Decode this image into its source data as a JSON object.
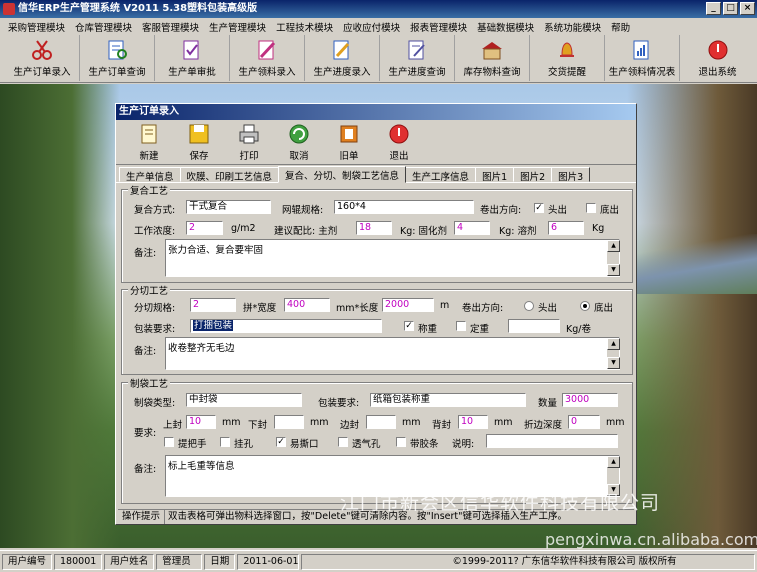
{
  "app": {
    "title": "信华ERP生产管理系统   V2011   5.38塑料包装高级版"
  },
  "window": {
    "min": "_",
    "max": "□",
    "close": "×"
  },
  "menu": [
    "采购管理模块",
    "仓库管理模块",
    "客服管理模块",
    "生产管理模块",
    "工程技术模块",
    "应收应付模块",
    "报表管理模块",
    "基础数据模块",
    "系统功能模块",
    "帮助"
  ],
  "toolbar": [
    {
      "label": "生产订单录入",
      "icon": "scissors-icon",
      "color": "#c02020"
    },
    {
      "label": "生产订单查询",
      "icon": "document-search-icon",
      "color": "#3060c0"
    },
    {
      "label": "生产单审批",
      "icon": "approve-icon",
      "color": "#8030a0"
    },
    {
      "label": "生产领料录入",
      "icon": "pen-icon",
      "color": "#c03080"
    },
    {
      "label": "生产进度录入",
      "icon": "pencil-icon",
      "color": "#3060c0"
    },
    {
      "label": "生产进度查询",
      "icon": "document-pen-icon",
      "color": "#5050a0"
    },
    {
      "label": "库存物料查询",
      "icon": "warehouse-icon",
      "color": "#b02020"
    },
    {
      "label": "交货提醒",
      "icon": "bell-icon",
      "color": "#c03030"
    },
    {
      "label": "生产领料情况表",
      "icon": "report-icon",
      "color": "#3060c0"
    },
    {
      "label": "退出系统",
      "icon": "exit-icon",
      "color": "#d02020"
    }
  ],
  "dialog": {
    "title": "生产订单录入",
    "buttons": [
      {
        "label": "新建",
        "icon": "new-icon"
      },
      {
        "label": "保存",
        "icon": "save-icon"
      },
      {
        "label": "打印",
        "icon": "print-icon"
      },
      {
        "label": "取消",
        "icon": "cancel-icon"
      },
      {
        "label": "旧单",
        "icon": "old-order-icon"
      },
      {
        "label": "退出",
        "icon": "exit-icon"
      }
    ],
    "tabs": [
      "生产单信息",
      "吹膜、印刷工艺信息",
      "复合、分切、制袋工艺信息",
      "生产工序信息",
      "图片1",
      "图片2",
      "图片3"
    ],
    "composite": {
      "legend": "复合工艺",
      "method_label": "复合方式:",
      "method": "干式复合",
      "roll_label": "网辊规格:",
      "roll": "160*4",
      "out_dir_label": "卷出方向:",
      "head": "头出",
      "bottom": "底出",
      "thickness_label": "工作浓度:",
      "thickness": "2",
      "thickness_unit": "g/m2",
      "ratio_label": "建议配比: 主剂",
      "main": "18",
      "kg1": "Kg: 固化剂",
      "cure": "4",
      "kg2": "Kg: 溶剂",
      "solvent": "6",
      "kg3": "Kg",
      "remark_label": "备注:",
      "remark": "张力合适、复合要牢固"
    },
    "slit": {
      "legend": "分切工艺",
      "spec_label": "分切规格:",
      "spec": "2",
      "width_label": "拼*宽度",
      "width": "400",
      "len_label": "mm*长度",
      "len": "2000",
      "m": "m",
      "out_dir_label": "卷出方向:",
      "head": "头出",
      "bottom": "底出",
      "pack_label": "包装要求:",
      "pack": "打捆包装",
      "weigh": "称重",
      "fixed": "定重",
      "kg": "Kg/卷",
      "remark_label": "备注:",
      "remark": "收卷整齐无毛边"
    },
    "bag": {
      "legend": "制袋工艺",
      "type_label": "制袋类型:",
      "type": "中封袋",
      "pack_label": "包装要求:",
      "pack": "纸箱包装称重",
      "qty_label": "数量",
      "qty": "3000",
      "req_label": "要求:",
      "top_label": "上封",
      "top": "10",
      "mm": "mm",
      "bottom_label": "下封",
      "side_label": "边封",
      "back_label": "背封",
      "back": "10",
      "fold_label": "折边深度",
      "fold": "0",
      "handle": "提把手",
      "hang": "挂孔",
      "tear": "易撕口",
      "vent": "透气孔",
      "glue": "带胶条",
      "desc_label": "说明:",
      "remark_label": "备注:",
      "remark": "标上毛重等信息"
    },
    "hint_label": "操作提示",
    "hint": "双击表格可弹出物料选择窗口，按\"Delete\"键可清除内容。按\"Insert\"键可选择插入生产工序。"
  },
  "watermark": "江门市新会区信华软件科技有限公司",
  "watermark2": "pengxinwa.cn.alibaba.com",
  "status": {
    "user_no_label": "用户编号",
    "user_no": "180001",
    "user_name_label": "用户姓名",
    "user_name": "管理员",
    "date_label": "日期",
    "date": "2011-06-01",
    "copyright": "©1999-2011?   广东信华软件科技有限公司   版权所有"
  }
}
